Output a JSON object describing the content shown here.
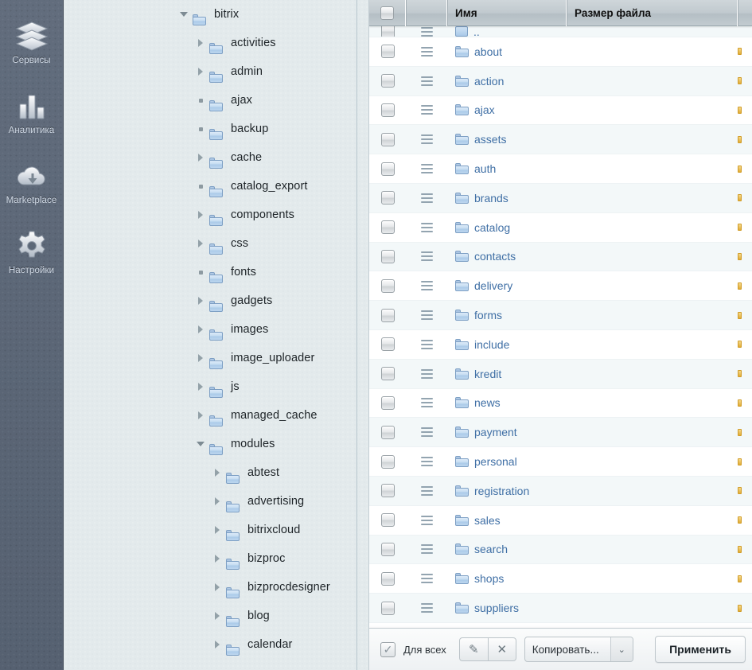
{
  "rail": {
    "items": [
      {
        "label": "Сервисы",
        "icon": "layers-icon"
      },
      {
        "label": "Аналитика",
        "icon": "bar-chart-icon"
      },
      {
        "label": "Marketplace",
        "icon": "cloud-download-icon"
      },
      {
        "label": "Настройки",
        "icon": "gear-icon"
      }
    ]
  },
  "tree": {
    "nodes": [
      {
        "label": "bitrix",
        "depth": 0,
        "marker": "expanded"
      },
      {
        "label": "activities",
        "depth": 1,
        "marker": "collapsed"
      },
      {
        "label": "admin",
        "depth": 1,
        "marker": "collapsed"
      },
      {
        "label": "ajax",
        "depth": 1,
        "marker": "leaf"
      },
      {
        "label": "backup",
        "depth": 1,
        "marker": "leaf"
      },
      {
        "label": "cache",
        "depth": 1,
        "marker": "collapsed"
      },
      {
        "label": "catalog_export",
        "depth": 1,
        "marker": "leaf"
      },
      {
        "label": "components",
        "depth": 1,
        "marker": "collapsed"
      },
      {
        "label": "css",
        "depth": 1,
        "marker": "collapsed"
      },
      {
        "label": "fonts",
        "depth": 1,
        "marker": "leaf"
      },
      {
        "label": "gadgets",
        "depth": 1,
        "marker": "collapsed"
      },
      {
        "label": "images",
        "depth": 1,
        "marker": "collapsed"
      },
      {
        "label": "image_uploader",
        "depth": 1,
        "marker": "collapsed"
      },
      {
        "label": "js",
        "depth": 1,
        "marker": "collapsed"
      },
      {
        "label": "managed_cache",
        "depth": 1,
        "marker": "collapsed"
      },
      {
        "label": "modules",
        "depth": 1,
        "marker": "expanded"
      },
      {
        "label": "abtest",
        "depth": 2,
        "marker": "collapsed"
      },
      {
        "label": "advertising",
        "depth": 2,
        "marker": "collapsed"
      },
      {
        "label": "bitrixcloud",
        "depth": 2,
        "marker": "collapsed"
      },
      {
        "label": "bizproc",
        "depth": 2,
        "marker": "collapsed"
      },
      {
        "label": "bizprocdesigner",
        "depth": 2,
        "marker": "collapsed"
      },
      {
        "label": "blog",
        "depth": 2,
        "marker": "collapsed"
      },
      {
        "label": "calendar",
        "depth": 2,
        "marker": "collapsed"
      }
    ]
  },
  "grid": {
    "columns": {
      "select": "",
      "menu": "",
      "name": "Имя",
      "size": "Размер файла",
      "extra": ""
    },
    "rows": [
      {
        "name": "..",
        "icon": "up-folder-icon",
        "size": "",
        "clipped": true
      },
      {
        "name": "about",
        "icon": "folder-icon",
        "size": ""
      },
      {
        "name": "action",
        "icon": "folder-icon",
        "size": ""
      },
      {
        "name": "ajax",
        "icon": "folder-icon",
        "size": ""
      },
      {
        "name": "assets",
        "icon": "folder-icon",
        "size": ""
      },
      {
        "name": "auth",
        "icon": "folder-icon",
        "size": ""
      },
      {
        "name": "brands",
        "icon": "folder-icon",
        "size": ""
      },
      {
        "name": "catalog",
        "icon": "folder-icon",
        "size": ""
      },
      {
        "name": "contacts",
        "icon": "folder-icon",
        "size": ""
      },
      {
        "name": "delivery",
        "icon": "folder-icon",
        "size": ""
      },
      {
        "name": "forms",
        "icon": "folder-icon",
        "size": ""
      },
      {
        "name": "include",
        "icon": "folder-icon",
        "size": ""
      },
      {
        "name": "kredit",
        "icon": "folder-icon",
        "size": ""
      },
      {
        "name": "news",
        "icon": "folder-icon",
        "size": ""
      },
      {
        "name": "payment",
        "icon": "folder-icon",
        "size": ""
      },
      {
        "name": "personal",
        "icon": "folder-icon",
        "size": ""
      },
      {
        "name": "registration",
        "icon": "folder-icon",
        "size": ""
      },
      {
        "name": "sales",
        "icon": "folder-icon",
        "size": ""
      },
      {
        "name": "search",
        "icon": "folder-icon",
        "size": ""
      },
      {
        "name": "shops",
        "icon": "folder-icon",
        "size": ""
      },
      {
        "name": "suppliers",
        "icon": "folder-icon",
        "size": ""
      }
    ]
  },
  "action_bar": {
    "select_all_label": "Для всех",
    "select_all_checked": true,
    "check_glyph": "✓",
    "edit_glyph": "✎",
    "delete_glyph": "✕",
    "action_select_value": "Копировать...",
    "apply_label": "Применить",
    "caret_glyph": "⌄"
  },
  "colors": {
    "rail_bg": "#5d6878",
    "tree_bg": "#e3eaec",
    "link": "#3f6fa5",
    "header_bg": "#c0c9ce",
    "row_alt": "#f3f8f9"
  }
}
